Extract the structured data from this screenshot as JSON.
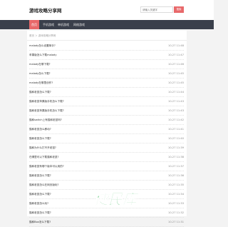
{
  "header": {
    "logo": "游戏攻略分享网",
    "search_placeholder": "请输入关键字",
    "search_button": "搜索"
  },
  "nav": [
    {
      "label": "首页",
      "active": true
    },
    {
      "label": "手机游戏",
      "active": false
    },
    {
      "label": "单机游戏",
      "active": false
    },
    {
      "label": "网络游戏",
      "active": false
    }
  ],
  "breadcrumb": "首页 ＞ 游戏攻略分享网",
  "list": [
    {
      "title": "malody怎么设置单手?",
      "date": "10-27 11:48"
    },
    {
      "title": "苹果版怎么下载malody",
      "date": "10-27 11:47"
    },
    {
      "title": "malody在哪下载?",
      "date": "10-27 11:46"
    },
    {
      "title": "malody怎么下载?",
      "date": "10-27 11:45"
    },
    {
      "title": "malody在哪里创作?",
      "date": "10-27 11:45"
    },
    {
      "title": "猫和老鼠怎么下载?",
      "date": "10-27 11:44"
    },
    {
      "title": "猫和老鼠苹果版手机怎么下载?",
      "date": "10-27 11:43"
    },
    {
      "title": "猫和老鼠苹果版手机怎么下载?",
      "date": "10-27 11:43"
    },
    {
      "title": "猫和switch上有猫和老鼠吗?",
      "date": "10-27 11:42"
    },
    {
      "title": "猫和老鼠怎么移动?",
      "date": "10-27 11:41"
    },
    {
      "title": "猫和老鼠怎么下载?",
      "date": "10-27 11:40"
    },
    {
      "title": "猫和为什么打不开老鼠?",
      "date": "10-27 11:39"
    },
    {
      "title": "在哪里可以下载猫和老鼠?",
      "date": "10-27 11:38"
    },
    {
      "title": "猫和老鼠有哪个版本可以用的?",
      "date": "10-27 11:37"
    },
    {
      "title": "猫和老鼠怎么下载?",
      "date": "10-27 11:36"
    },
    {
      "title": "猫和老鼠怎么在网页版玩?",
      "date": "10-27 11:35"
    },
    {
      "title": "猫和老鼠怎么下载?",
      "date": "10-27 11:34"
    },
    {
      "title": "猫和老鼠怎么玩?",
      "date": "10-27 11:33"
    },
    {
      "title": "猫和老鼠怎么下载?",
      "date": "10-27 11:32"
    },
    {
      "title": "猫和Box怎么下载?",
      "date": "10-27 11:31"
    }
  ],
  "watermark": "便民库",
  "colors": {
    "accent": "#e8686a",
    "navbar": "#3a3f4b",
    "watermark": "#3bb85a"
  }
}
